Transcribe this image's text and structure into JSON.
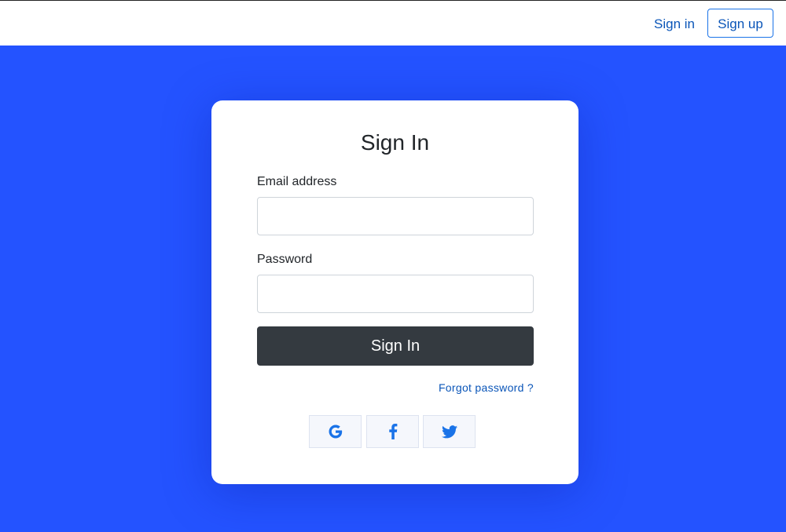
{
  "navbar": {
    "signin_label": "Sign in",
    "signup_label": "Sign up"
  },
  "form": {
    "title": "Sign In",
    "email": {
      "label": "Email address",
      "value": "",
      "placeholder": ""
    },
    "password": {
      "label": "Password",
      "value": "",
      "placeholder": ""
    },
    "submit_label": "Sign In",
    "forgot_label": "Forgot password ?"
  },
  "social": {
    "icons": [
      "google-icon",
      "facebook-icon",
      "twitter-icon"
    ]
  },
  "colors": {
    "background": "#2453ff",
    "link": "#0a55b8",
    "button_dark": "#343a40",
    "social_icon": "#1a73e8"
  }
}
